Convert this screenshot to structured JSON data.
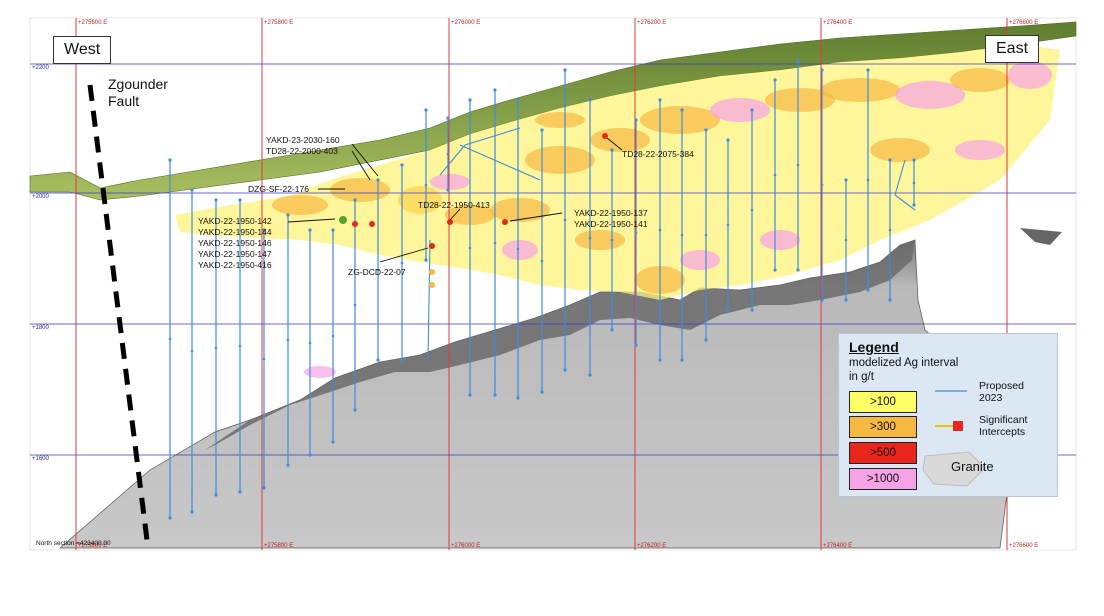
{
  "direction_labels": {
    "west": "West",
    "east": "East"
  },
  "fault_label": {
    "line1": "Zgounder",
    "line2": "Fault"
  },
  "easting_ticks": [
    "275600 E",
    "275800 E",
    "276000 E",
    "276200 E",
    "276400 E",
    "276600 E"
  ],
  "elevation_ticks": [
    "2200",
    "2000",
    "1800",
    "1600"
  ],
  "section_note": "North section =423400.00",
  "drill_labels": [
    "YAKD-23-2030-160",
    "TD28-22-2000-403",
    "DZG-SF-22-176",
    "YAKD-22-1950-142",
    "YAKD-22-1950-144",
    "YAKD-22-1950-146",
    "YAKD-22-1950-147",
    "YAKD-22-1950-416",
    "ZG-DCD-22-07",
    "TD28-22-1950-413",
    "YAKD-22-1950-137",
    "YAKD-22-1950-141",
    "TD28-22-2075-384"
  ],
  "legend": {
    "title": "Legend",
    "subtitle_1": "modelized Ag interval",
    "subtitle_2": "in g/t",
    "proposed": "Proposed",
    "proposed_year": "2023",
    "significant": "Significant",
    "intercepts": "Intercepts",
    "granite": "Granite",
    "classes": [
      {
        "label": ">100",
        "color": "#ffff66"
      },
      {
        "label": ">300",
        "color": "#f5b942"
      },
      {
        "label": ">500",
        "color": "#e8261c"
      },
      {
        "label": ">1000",
        "color": "#f5a3e6"
      }
    ]
  },
  "colors": {
    "grid_red": "#e0393e",
    "grid_blue": "#3a3acc",
    "drill_blue": "#3d8de0",
    "surface_green": "#6e8f3c",
    "granite_grey": "#b5b5b5"
  }
}
